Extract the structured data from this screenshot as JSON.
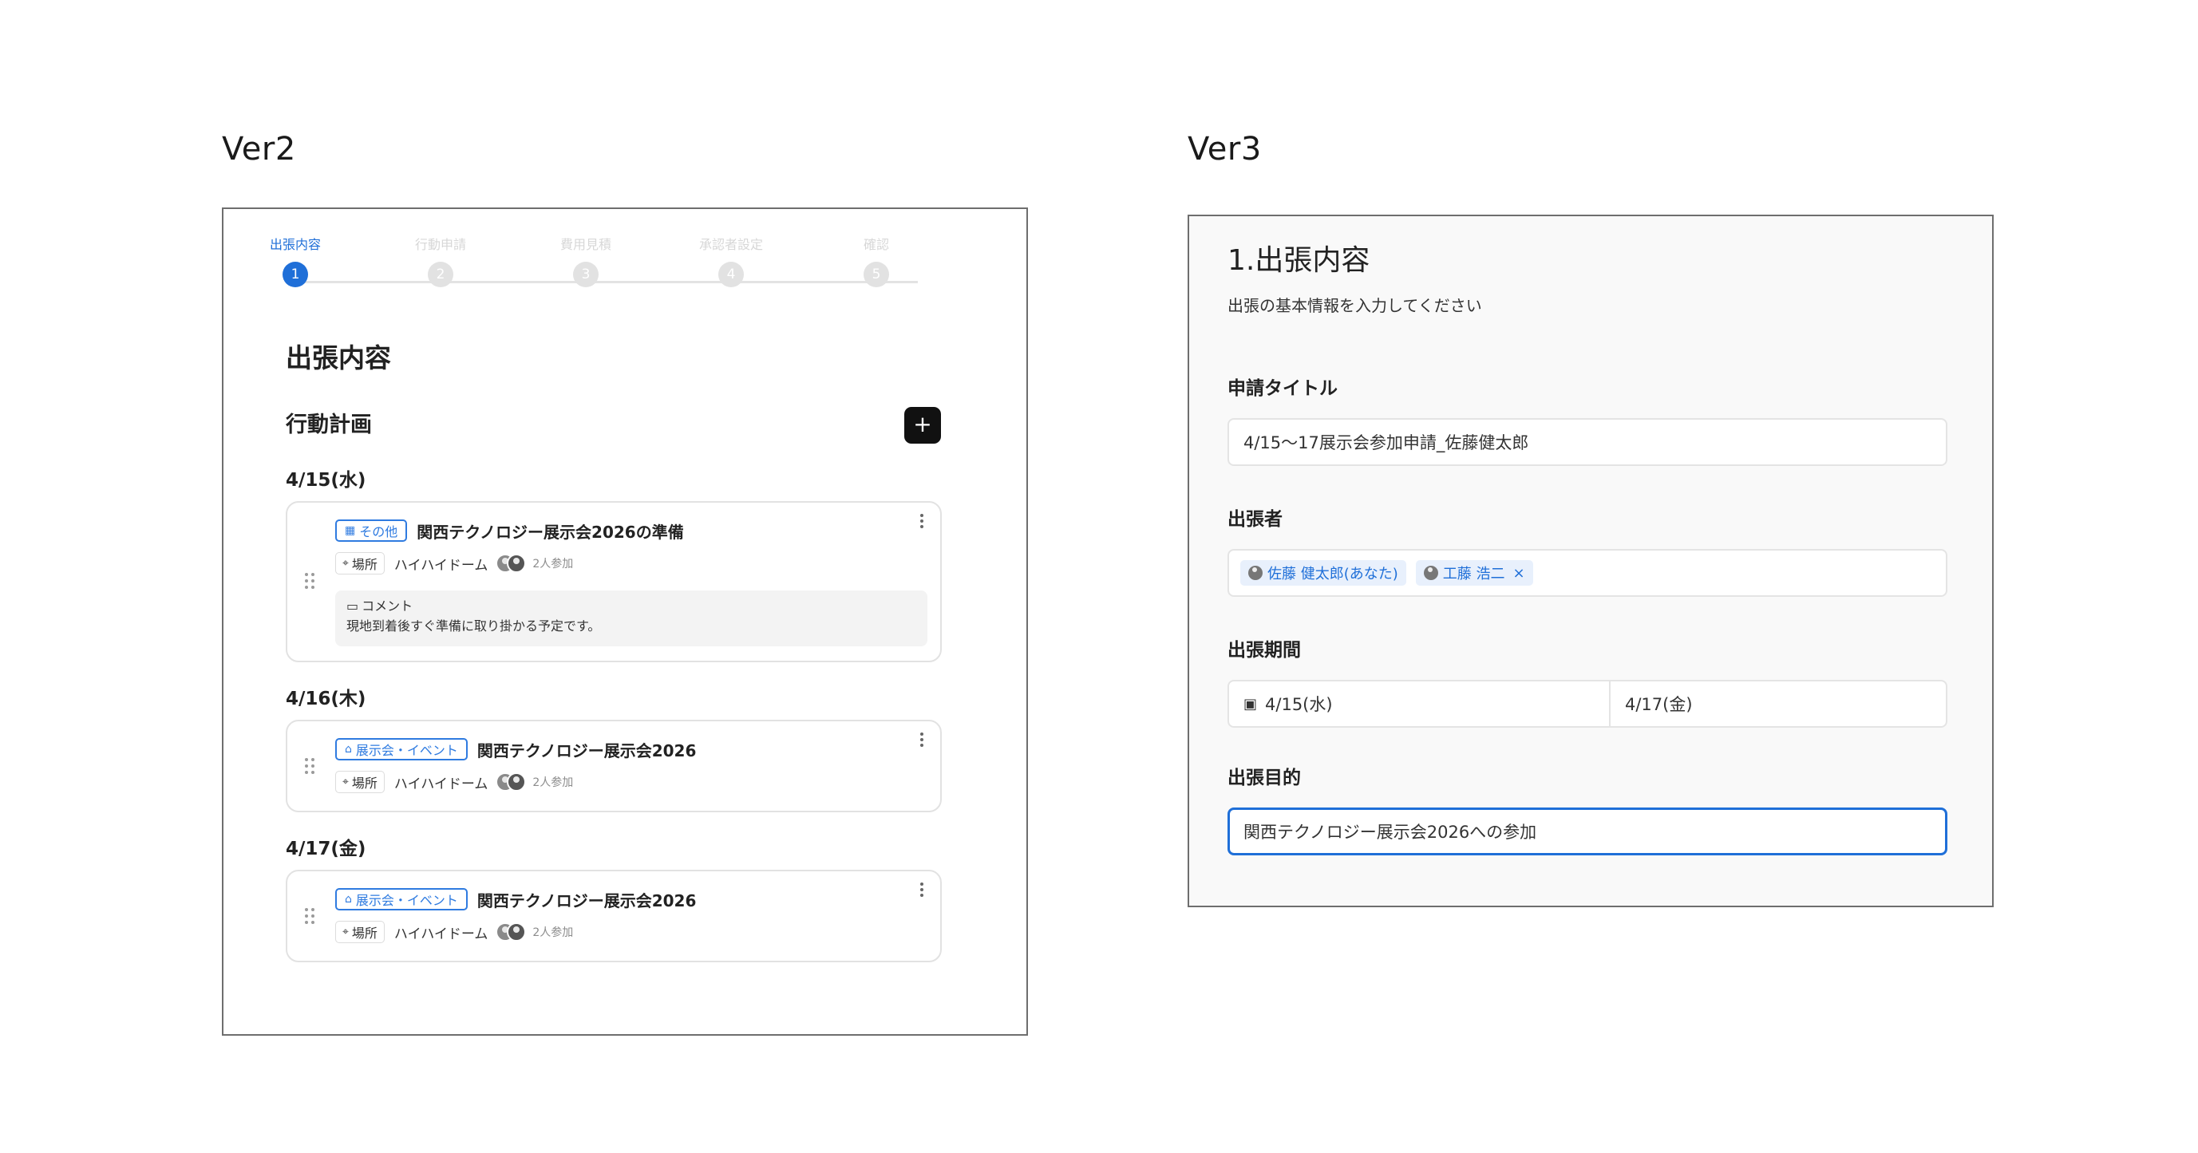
{
  "labels": {
    "v2": "Ver2",
    "v3": "Ver3"
  },
  "v2": {
    "stepper": {
      "steps": [
        {
          "label": "出張内容",
          "number": "1",
          "active": true
        },
        {
          "label": "行動申請",
          "number": "2",
          "active": false
        },
        {
          "label": "費用見積",
          "number": "3",
          "active": false
        },
        {
          "label": "承認者設定",
          "number": "4",
          "active": false
        },
        {
          "label": "確認",
          "number": "5",
          "active": false
        }
      ]
    },
    "title": "出張内容",
    "section_title": "行動計画",
    "add_button": "+",
    "days": [
      {
        "date": "4/15(水)",
        "card": {
          "tag_icon": "grid-icon",
          "tag": "その他",
          "title": "関西テクノロジー展示会2026の準備",
          "place_label": "場所",
          "place": "ハイハイドーム",
          "attendees": "2人参加",
          "comment_label": "コメント",
          "comment": "現地到着後すぐ準備に取り掛かる予定です。"
        }
      },
      {
        "date": "4/16(木)",
        "card": {
          "tag_icon": "building-icon",
          "tag": "展示会・イベント",
          "title": "関西テクノロジー展示会2026",
          "place_label": "場所",
          "place": "ハイハイドーム",
          "attendees": "2人参加"
        }
      },
      {
        "date": "4/17(金)",
        "card": {
          "tag_icon": "building-icon",
          "tag": "展示会・イベント",
          "title": "関西テクノロジー展示会2026",
          "place_label": "場所",
          "place": "ハイハイドーム",
          "attendees": "2人参加"
        }
      }
    ]
  },
  "v3": {
    "title": "1.出張内容",
    "subtitle": "出張の基本情報を入力してください",
    "application_title": {
      "label": "申請タイトル",
      "value": "4/15〜17展示会参加申請_佐藤健太郎"
    },
    "travelers": {
      "label": "出張者",
      "members": [
        {
          "name": "佐藤 健太郎(あなた)",
          "removable": false
        },
        {
          "name": "工藤 浩二",
          "removable": true,
          "remove": "×"
        }
      ]
    },
    "period": {
      "label": "出張期間",
      "from": "4/15(水)",
      "to": "4/17(金)"
    },
    "purpose": {
      "label": "出張目的",
      "value": "関西テクノロジー展示会2026への参加"
    }
  },
  "colors": {
    "accent": "#1f6fd8",
    "frame_border": "#6e6e6e",
    "chip_bg": "#e8f0fc"
  }
}
